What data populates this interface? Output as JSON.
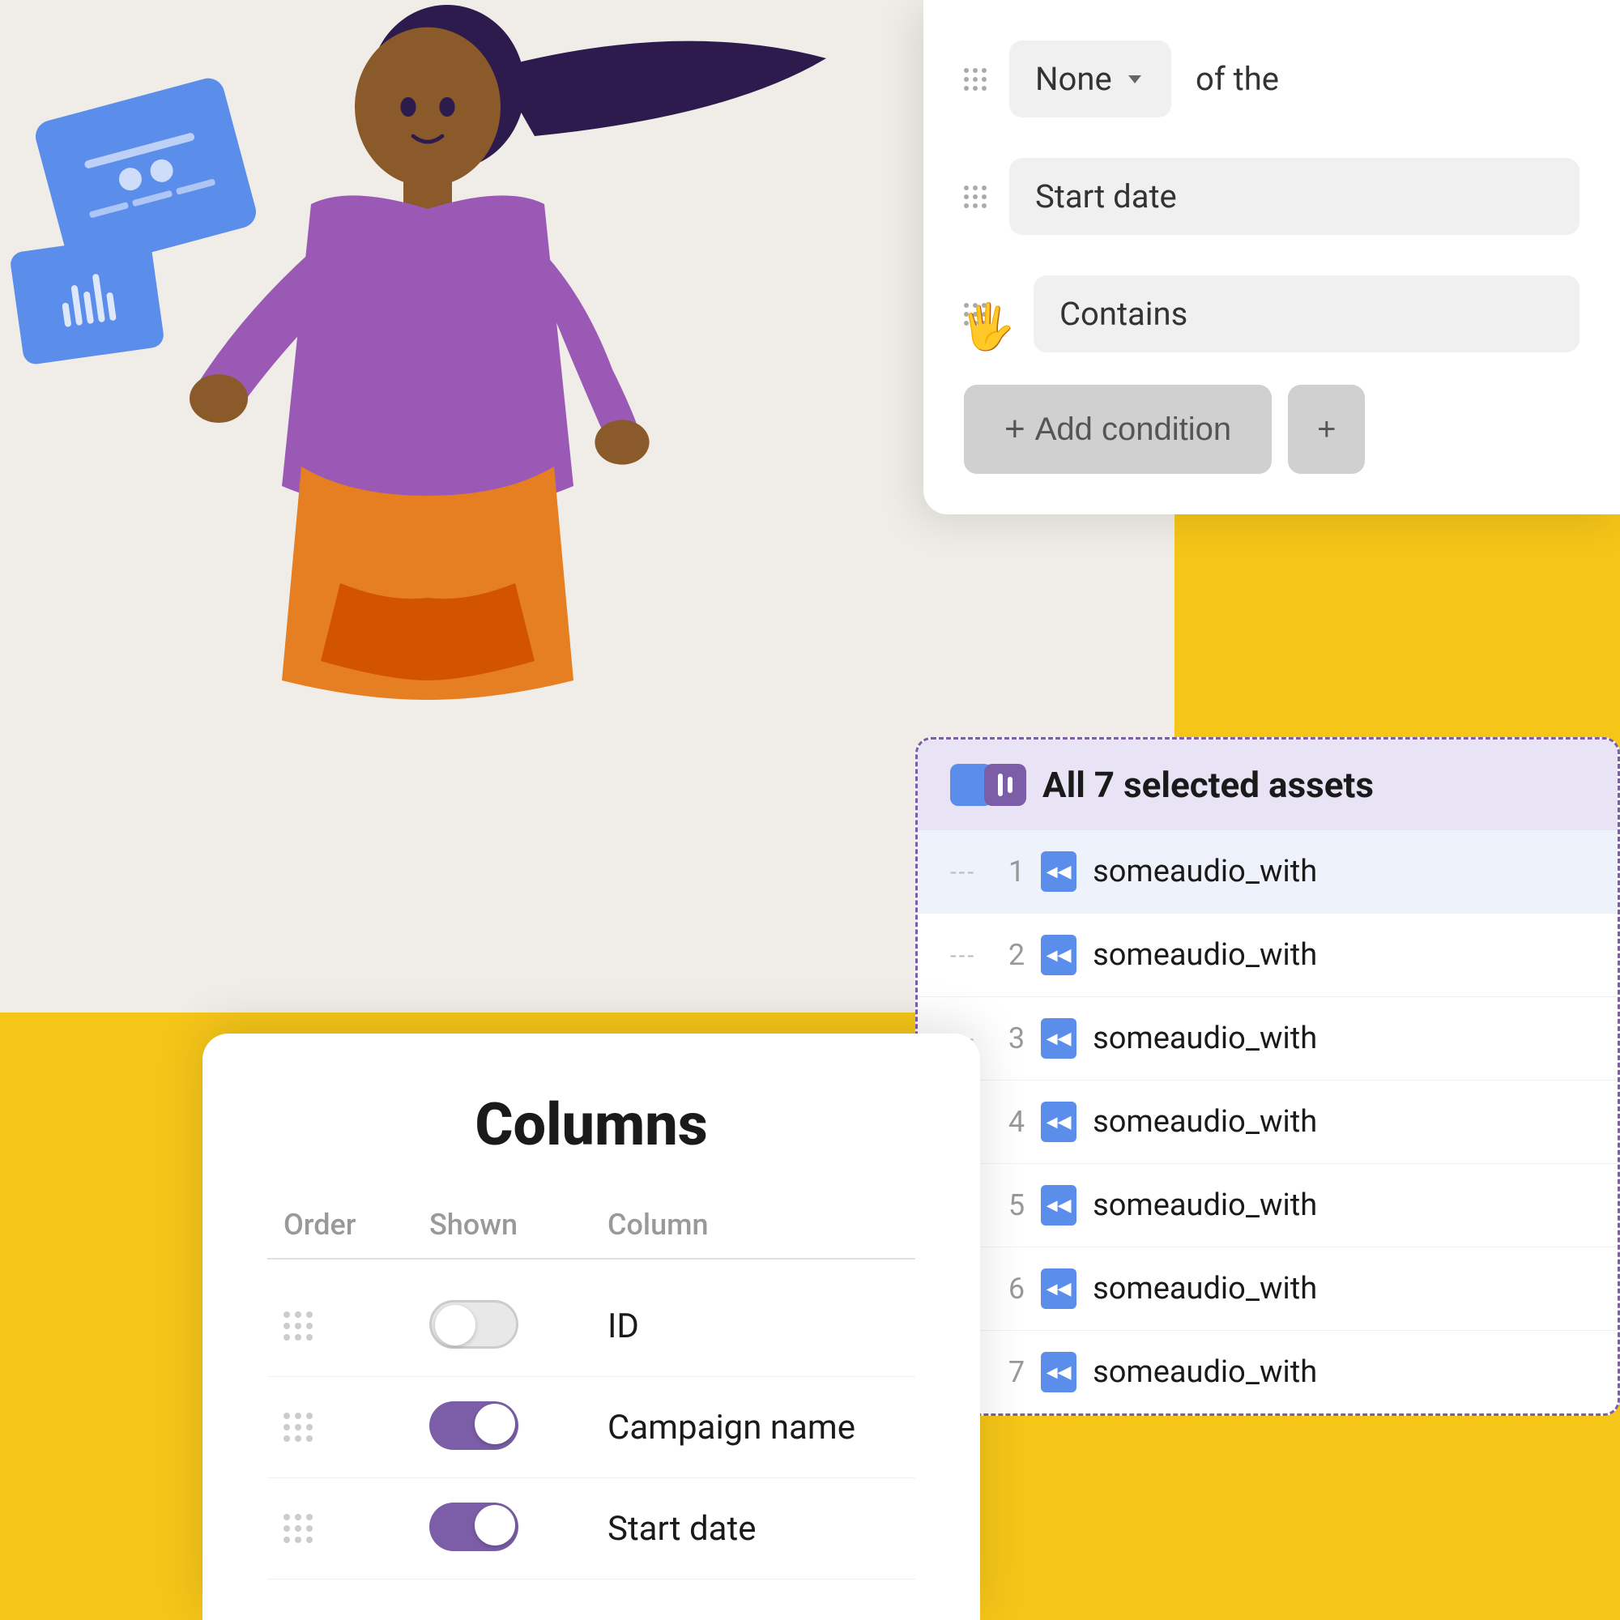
{
  "illustration": {
    "bg_color": "#F0EDE8",
    "yellow_bg": "#F5C518"
  },
  "columns_panel": {
    "title": "Columns",
    "headers": {
      "order": "Order",
      "shown": "Shown",
      "column": "Column"
    },
    "rows": [
      {
        "id": 1,
        "label": "ID",
        "toggle": "off"
      },
      {
        "id": 2,
        "label": "Campaign name",
        "toggle": "on"
      },
      {
        "id": 3,
        "label": "Start date",
        "toggle": "on-partial"
      }
    ]
  },
  "filter_panel": {
    "row1": {
      "select_label": "None",
      "of_the_text": "of the"
    },
    "row2": {
      "field_label": "Start date"
    },
    "row3": {
      "condition_label": "Contains"
    },
    "add_condition_label": "Add condition",
    "more_label": "..."
  },
  "asset_panel": {
    "header": "All 7 selected assets",
    "items": [
      {
        "num": "1",
        "name": "someaudio_with"
      },
      {
        "num": "2",
        "name": "someaudio_with"
      },
      {
        "num": "3",
        "name": "someaudio_with"
      },
      {
        "num": "4",
        "name": "someaudio_with"
      },
      {
        "num": "5",
        "name": "someaudio_with"
      },
      {
        "num": "6",
        "name": "someaudio_with"
      },
      {
        "num": "7",
        "name": "someaudio_with"
      }
    ]
  },
  "icons": {
    "drag_dots": "⋮⋮",
    "plus": "+",
    "chevron": "▾",
    "audio": "◀",
    "file": "🎵"
  }
}
